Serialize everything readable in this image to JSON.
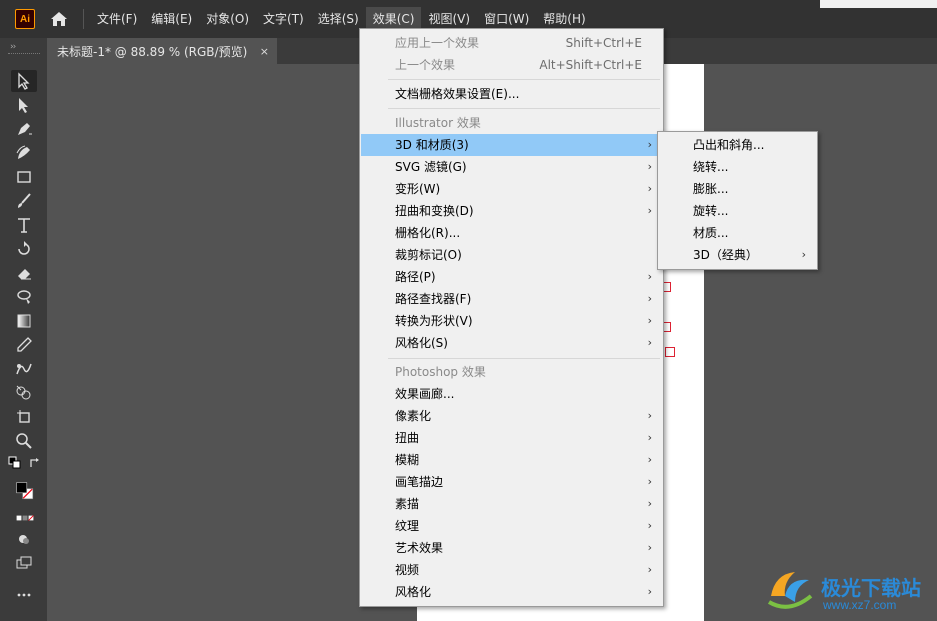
{
  "app": {
    "logo": "Ai",
    "home_icon": "home-icon"
  },
  "menubar": {
    "items": [
      "文件(F)",
      "编辑(E)",
      "对象(O)",
      "文字(T)",
      "选择(S)",
      "效果(C)",
      "视图(V)",
      "窗口(W)",
      "帮助(H)"
    ],
    "active": "效果(C)"
  },
  "document_tab": {
    "title": "未标题-1* @ 88.89 % (RGB/预览)",
    "close": "×"
  },
  "tools": [
    "selection-tool",
    "direct-selection-tool",
    "pen-tool",
    "curvature-tool",
    "rectangle-tool",
    "paintbrush-tool",
    "type-tool",
    "rotate-tool",
    "eraser-tool",
    "lasso-tool",
    "gradient-tool",
    "eyedropper-tool",
    "blend-tool",
    "shape-builder-tool",
    "artboard-tool",
    "zoom-tool"
  ],
  "effects_menu": {
    "apply_last": {
      "label": "应用上一个效果",
      "shortcut": "Shift+Ctrl+E"
    },
    "last_effect": {
      "label": "上一个效果",
      "shortcut": "Alt+Shift+Ctrl+E"
    },
    "raster_settings": "文档栅格效果设置(E)...",
    "illustrator_header": "Illustrator 效果",
    "illustrator_items": [
      {
        "label": "3D 和材质(3)",
        "submenu": true
      },
      {
        "label": "SVG 滤镜(G)",
        "submenu": true
      },
      {
        "label": "变形(W)",
        "submenu": true
      },
      {
        "label": "扭曲和变换(D)",
        "submenu": true
      },
      {
        "label": "栅格化(R)...",
        "submenu": false
      },
      {
        "label": "裁剪标记(O)",
        "submenu": false
      },
      {
        "label": "路径(P)",
        "submenu": true
      },
      {
        "label": "路径查找器(F)",
        "submenu": true
      },
      {
        "label": "转换为形状(V)",
        "submenu": true
      },
      {
        "label": "风格化(S)",
        "submenu": true
      }
    ],
    "photoshop_header": "Photoshop 效果",
    "photoshop_items": [
      {
        "label": "效果画廊...",
        "submenu": false
      },
      {
        "label": "像素化",
        "submenu": true
      },
      {
        "label": "扭曲",
        "submenu": true
      },
      {
        "label": "模糊",
        "submenu": true
      },
      {
        "label": "画笔描边",
        "submenu": true
      },
      {
        "label": "素描",
        "submenu": true
      },
      {
        "label": "纹理",
        "submenu": true
      },
      {
        "label": "艺术效果",
        "submenu": true
      },
      {
        "label": "视频",
        "submenu": true
      },
      {
        "label": "风格化",
        "submenu": true
      }
    ]
  },
  "submenu_3d": {
    "items": [
      {
        "label": "凸出和斜角...",
        "submenu": false
      },
      {
        "label": "绕转...",
        "submenu": false
      },
      {
        "label": "膨胀...",
        "submenu": false
      },
      {
        "label": "旋转...",
        "submenu": false
      },
      {
        "label": "材质...",
        "submenu": false
      },
      {
        "label": "3D（经典）",
        "submenu": true
      }
    ]
  },
  "watermark": {
    "text": "极光下载站",
    "url": "www.xz7.com"
  },
  "colors": {
    "highlight": "#91c9f7",
    "menu_bg": "#f0f0f0",
    "ui_dark": "#323232",
    "canvas": "#535353"
  }
}
